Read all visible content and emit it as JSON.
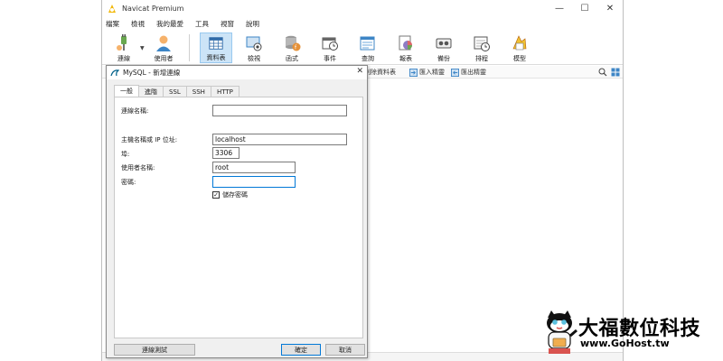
{
  "app": {
    "title": "Navicat Premium",
    "window_controls": {
      "minimize": "—",
      "maximize": "☐",
      "close": "✕"
    }
  },
  "menu": [
    "檔案",
    "檢視",
    "我的最愛",
    "工具",
    "視窗",
    "說明"
  ],
  "toolbar": {
    "buttons": [
      {
        "label": "連線",
        "icon": "plug-icon"
      },
      {
        "label": "使用者",
        "icon": "user-icon"
      },
      {
        "label": "資料表",
        "icon": "table-icon",
        "active": true
      },
      {
        "label": "檢視",
        "icon": "view-icon"
      },
      {
        "label": "函式",
        "icon": "function-icon"
      },
      {
        "label": "事件",
        "icon": "event-icon"
      },
      {
        "label": "查詢",
        "icon": "query-icon"
      },
      {
        "label": "報表",
        "icon": "report-icon"
      },
      {
        "label": "備份",
        "icon": "backup-icon"
      },
      {
        "label": "排程",
        "icon": "schedule-icon"
      },
      {
        "label": "模型",
        "icon": "model-icon"
      }
    ]
  },
  "subtoolbar": {
    "delete_table": "刪除資料表",
    "import_wizard": "匯入精靈",
    "export_wizard": "匯出精靈"
  },
  "dialog": {
    "title": "MySQL - 新增連線",
    "close": "✕",
    "tabs": [
      "一般",
      "進階",
      "SSL",
      "SSH",
      "HTTP"
    ],
    "fields": {
      "connection_name_label": "連線名稱:",
      "connection_name_value": "",
      "host_label": "主機名稱或 IP 位址:",
      "host_value": "localhost",
      "port_label": "埠:",
      "port_value": "3306",
      "username_label": "使用者名稱:",
      "username_value": "root",
      "password_label": "密碼:",
      "password_value": "",
      "save_password_label": "儲存密碼",
      "save_password_checked": "✓"
    },
    "buttons": {
      "test": "連線測試",
      "ok": "確定",
      "cancel": "取消"
    }
  },
  "brand": {
    "name": "大福數位科技",
    "url": "www.GoHost.tw"
  },
  "colors": {
    "accent": "#0078d7",
    "active_tab_bg": "#cce4f7"
  }
}
